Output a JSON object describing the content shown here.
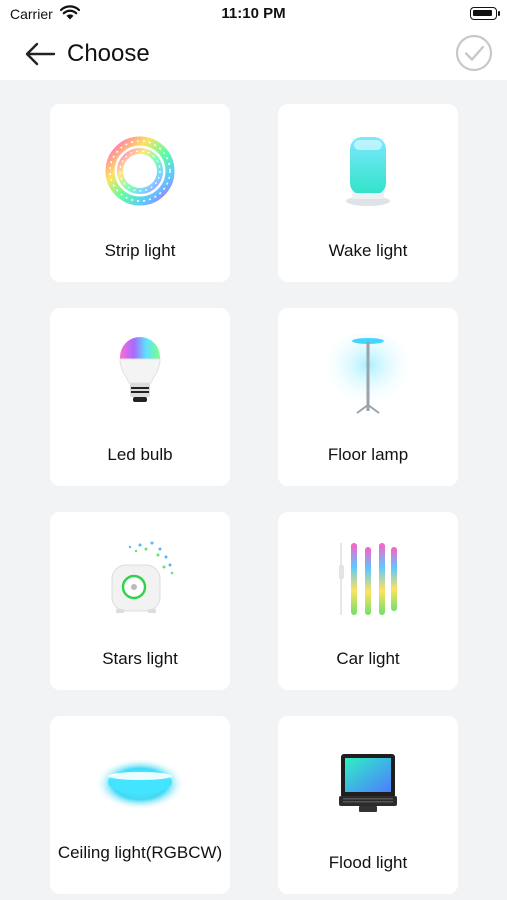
{
  "status": {
    "carrier": "Carrier",
    "time": "11:10 PM"
  },
  "nav": {
    "title": "Choose"
  },
  "devices": [
    {
      "label": "Strip light",
      "icon": "strip-light-icon"
    },
    {
      "label": "Wake light",
      "icon": "wake-light-icon"
    },
    {
      "label": "Led bulb",
      "icon": "led-bulb-icon"
    },
    {
      "label": "Floor lamp",
      "icon": "floor-lamp-icon"
    },
    {
      "label": "Stars light",
      "icon": "stars-light-icon"
    },
    {
      "label": "Car light",
      "icon": "car-light-icon"
    },
    {
      "label": "Ceiling light(RGBCW)",
      "icon": "ceiling-light-icon"
    },
    {
      "label": "Flood light",
      "icon": "flood-light-icon"
    }
  ]
}
